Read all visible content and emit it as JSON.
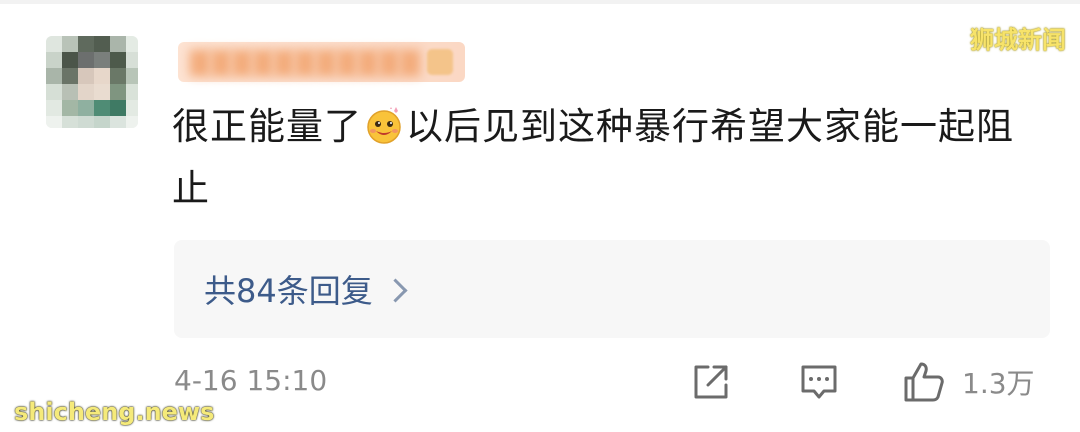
{
  "comment": {
    "text_part1": "很正能量了",
    "emoji_name": "happy-face-emoji",
    "text_part2": "以后见到这种暴行希望大家能一起阻止",
    "replies_label": "共84条回复",
    "timestamp": "4-16 15:10",
    "like_count": "1.3万"
  },
  "actions": {
    "share_icon": "share-icon",
    "reply_icon": "comment-icon",
    "like_icon": "thumbs-up-icon"
  },
  "watermarks": {
    "top": "狮城新闻",
    "bottom": "shicheng.news"
  },
  "colors": {
    "text": "#1a1a1a",
    "link": "#3d5b8a",
    "meta": "#8a8a8a",
    "reply_bg": "#f7f7f7"
  }
}
